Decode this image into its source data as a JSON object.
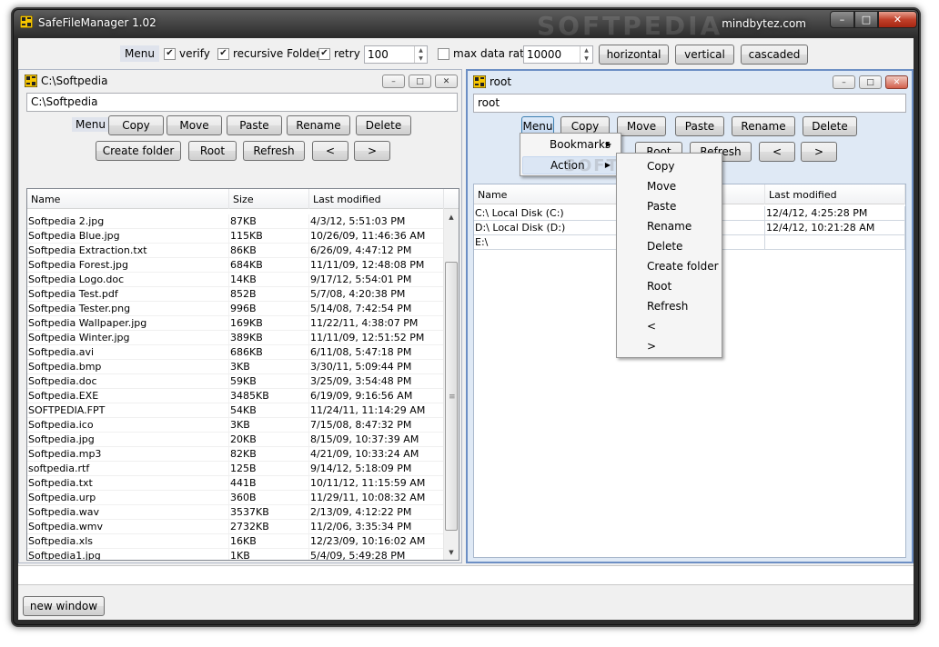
{
  "window": {
    "title": "SafeFileManager 1.02",
    "brand": "mindbytez.com",
    "watermark": "SOFTPEDIA",
    "min_glyph": "–",
    "max_glyph": "□",
    "close_glyph": "✕"
  },
  "toolbar": {
    "menu_label": "Menu",
    "verify": {
      "label": "verify",
      "checked": true
    },
    "recursive": {
      "label": "recursive Folders",
      "checked": true
    },
    "retry": {
      "label": "retry",
      "checked": true,
      "value": "100"
    },
    "max_rate": {
      "label": "max data rate",
      "checked": false,
      "value": "10000"
    },
    "horizontal_label": "horizontal",
    "vertical_label": "vertical",
    "cascaded_label": "cascaded"
  },
  "left_panel": {
    "title": "C:\\Softpedia",
    "path": "C:\\Softpedia",
    "menu_label": "Menu",
    "buttons": {
      "copy": "Copy",
      "move": "Move",
      "paste": "Paste",
      "rename": "Rename",
      "delete": "Delete",
      "create_folder": "Create folder",
      "root": "Root",
      "refresh": "Refresh",
      "back": "<",
      "forward": ">"
    },
    "columns": {
      "name": "Name",
      "size": "Size",
      "modified": "Last modified"
    },
    "rows": [
      [
        "Softpedia 2.jpg",
        "87KB",
        "4/3/12,  5:51:03 PM"
      ],
      [
        "Softpedia Blue.jpg",
        "115KB",
        "10/26/09,  11:46:36 AM"
      ],
      [
        "Softpedia Extraction.txt",
        "86KB",
        "6/26/09,  4:47:12 PM"
      ],
      [
        "Softpedia Forest.jpg",
        "684KB",
        "11/11/09,  12:48:08 PM"
      ],
      [
        "Softpedia Logo.doc",
        "14KB",
        "9/17/12,  5:54:01 PM"
      ],
      [
        "Softpedia Test.pdf",
        "852B",
        "5/7/08,  4:20:38 PM"
      ],
      [
        "Softpedia Tester.png",
        "996B",
        "5/14/08,  7:42:54 PM"
      ],
      [
        "Softpedia Wallpaper.jpg",
        "169KB",
        "11/22/11,  4:38:07 PM"
      ],
      [
        "Softpedia Winter.jpg",
        "389KB",
        "11/11/09,  12:51:52 PM"
      ],
      [
        "Softpedia.avi",
        "686KB",
        "6/11/08,  5:47:18 PM"
      ],
      [
        "Softpedia.bmp",
        "3KB",
        "3/30/11,  5:09:44 PM"
      ],
      [
        "Softpedia.doc",
        "59KB",
        "3/25/09,  3:54:48 PM"
      ],
      [
        "Softpedia.EXE",
        "3485KB",
        "6/19/09,  9:16:56 AM"
      ],
      [
        "SOFTPEDIA.FPT",
        "54KB",
        "11/24/11,  11:14:29 AM"
      ],
      [
        "Softpedia.ico",
        "3KB",
        "7/15/08,  8:47:32 PM"
      ],
      [
        "Softpedia.jpg",
        "20KB",
        "8/15/09,  10:37:39 AM"
      ],
      [
        "Softpedia.mp3",
        "82KB",
        "4/21/09,  10:33:24 AM"
      ],
      [
        "softpedia.rtf",
        "125B",
        "9/14/12,  5:18:09 PM"
      ],
      [
        "Softpedia.txt",
        "441B",
        "10/11/12,  11:15:59 AM"
      ],
      [
        "Softpedia.urp",
        "360B",
        "11/29/11,  10:08:32 AM"
      ],
      [
        "Softpedia.wav",
        "3537KB",
        "2/13/09,  4:12:22 PM"
      ],
      [
        "Softpedia.wmv",
        "2732KB",
        "11/2/06,  3:35:34 PM"
      ],
      [
        "Softpedia.xls",
        "16KB",
        "12/23/09,  10:16:02 AM"
      ],
      [
        "Softpedia1.jpg",
        "1KB",
        "5/4/09,  5:49:28 PM"
      ]
    ]
  },
  "right_panel": {
    "title": "root",
    "path": "root",
    "menu_label": "Menu",
    "buttons": {
      "copy": "Copy",
      "move": "Move",
      "paste": "Paste",
      "rename": "Rename",
      "delete": "Delete",
      "root": "Root",
      "refresh": "Refresh",
      "back": "<",
      "forward": ">"
    },
    "columns": {
      "name": "Name",
      "modified": "Last modified"
    },
    "rows": [
      [
        "C:\\ Local Disk (C:)",
        "12/4/12,  4:25:28 PM"
      ],
      [
        "D:\\ Local Disk (D:)",
        "12/4/12,  10:21:28 AM"
      ],
      [
        "E:\\",
        ""
      ]
    ]
  },
  "context_menu": {
    "bookmarks": "Bookmarks",
    "action": "Action",
    "submenu": [
      "Copy",
      "Move",
      "Paste",
      "Rename",
      "Delete",
      "Create folder",
      "Root",
      "Refresh",
      "<",
      ">"
    ]
  },
  "footer": {
    "new_window_label": "new window"
  },
  "colors": {
    "accent_border": "#6d8fc4",
    "close_red": "#c1412b",
    "selection": "#dbe6f4"
  }
}
